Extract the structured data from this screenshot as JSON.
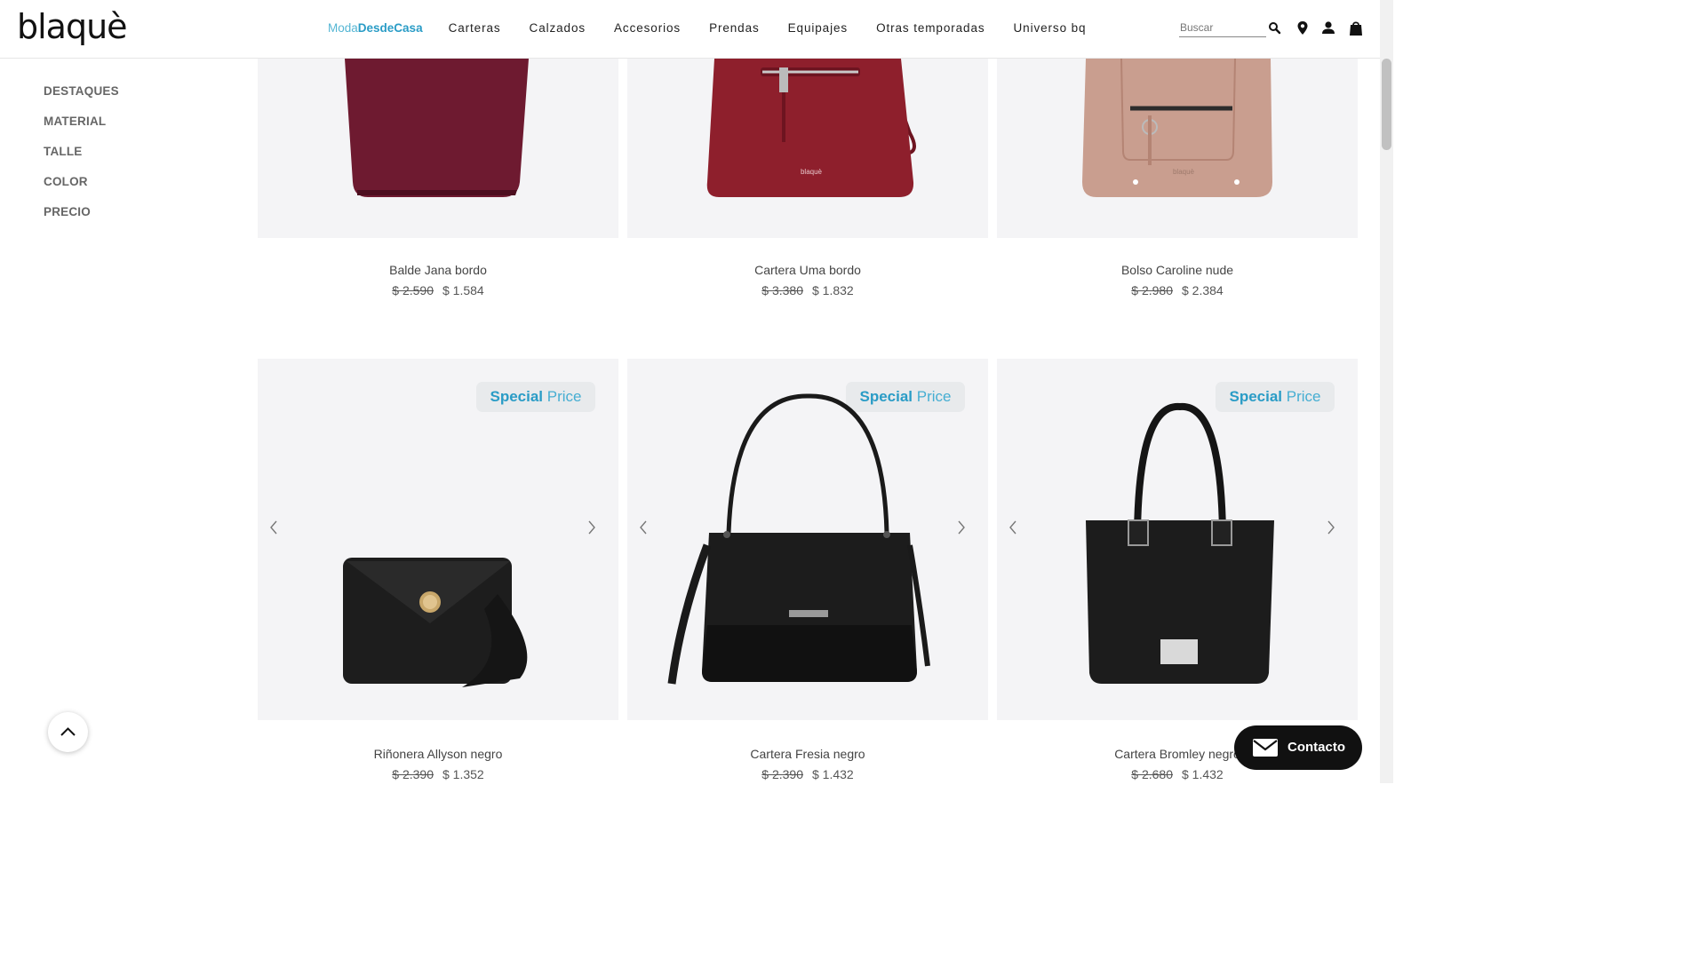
{
  "header": {
    "logo": "blaquè",
    "nav_moda_part1": "Moda",
    "nav_moda_part2": "DesdeCasa",
    "nav": [
      "Carteras",
      "Calzados",
      "Accesorios",
      "Prendas",
      "Equipajes",
      "Otras temporadas",
      "Universo bq"
    ],
    "search_placeholder": "Buscar",
    "icons": [
      "search-icon",
      "location-pin-icon",
      "user-icon",
      "shopping-bag-icon"
    ]
  },
  "filters": [
    "DESTAQUES",
    "MATERIAL",
    "TALLE",
    "COLOR",
    "PRECIO"
  ],
  "badge": {
    "part1": "Special",
    "part2": "Price"
  },
  "products": [
    {
      "name": "Balde Jana bordo",
      "old_price": "$ 2.590",
      "price": "$ 1.584",
      "color": "#6e1a30"
    },
    {
      "name": "Cartera Uma bordo",
      "old_price": "$ 3.380",
      "price": "$ 1.832",
      "color": "#8e1f2c"
    },
    {
      "name": "Bolso Caroline nude",
      "old_price": "$ 2.980",
      "price": "$ 2.384",
      "color": "#c99e8f"
    },
    {
      "name": "Riñonera Allyson negro",
      "old_price": "$ 2.390",
      "price": "$ 1.352",
      "color": "#1a1a1a"
    },
    {
      "name": "Cartera Fresia negro",
      "old_price": "$ 2.390",
      "price": "$ 1.432",
      "color": "#1a1a1a"
    },
    {
      "name": "Cartera Bromley negro",
      "old_price": "$ 2.680",
      "price": "$ 1.432",
      "color": "#1a1a1a"
    }
  ],
  "contact_label": "Contacto",
  "colors": {
    "accent": "#2a9cc6",
    "accent_light": "#55b6d4",
    "image_bg": "#f4f4f6",
    "contact_bg": "#111111"
  }
}
